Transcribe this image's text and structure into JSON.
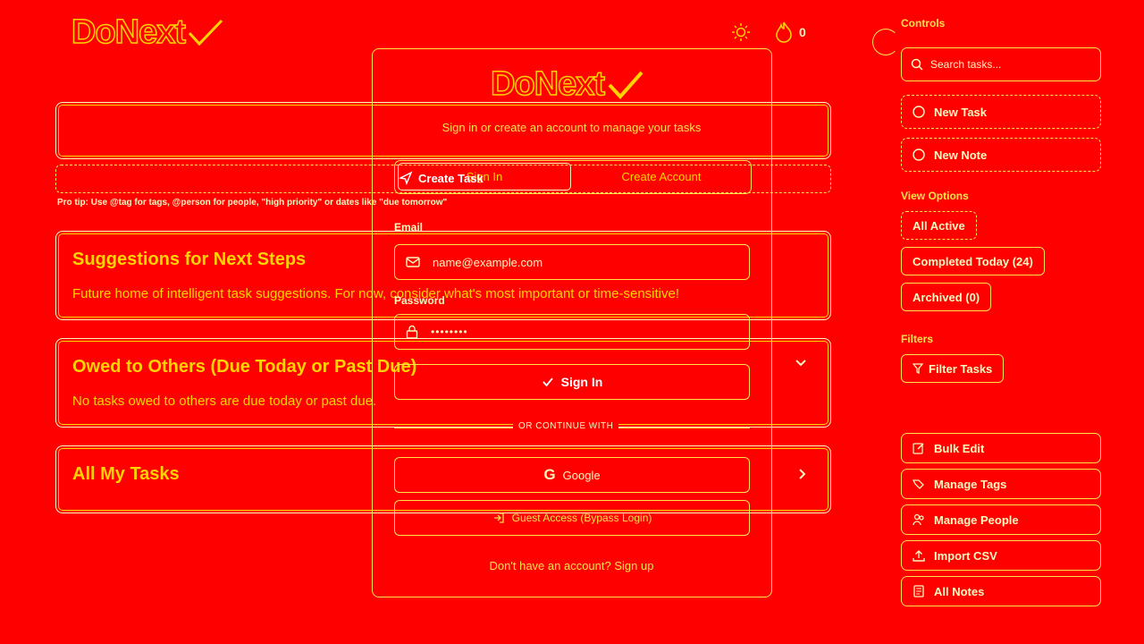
{
  "header": {
    "logo_text": "DoNext",
    "streak_count": "0"
  },
  "main": {
    "task_input_placeholder": "",
    "pro_tip": "Pro tip: Use @tag for tags, @person for people, \"high priority\" or dates like \"due tomorrow\"",
    "create_task_label": "Create Task",
    "cards": {
      "suggestions": {
        "title": "Suggestions for Next Steps",
        "text": "Future home of intelligent task suggestions. For now, consider what's most important or time-sensitive!"
      },
      "owed": {
        "title": "Owed to Others (Due Today or Past Due)",
        "text": "No tasks owed to others are due today or past due."
      },
      "all_tasks": {
        "title": "All My Tasks"
      }
    }
  },
  "modal": {
    "logo_text": "DoNext",
    "subtitle": "Sign in or create an account to manage your tasks",
    "tabs": {
      "sign_in": "Sign In",
      "create_account": "Create Account"
    },
    "email_label": "Email",
    "email_placeholder": "name@example.com",
    "password_label": "Password",
    "password_placeholder": "••••••••",
    "sign_in_button": "Sign In",
    "divider": "OR CONTINUE WITH",
    "google_button": "Google",
    "guest_button": "Guest Access (Bypass Login)",
    "signup_prompt": "Don't have an account? Sign up"
  },
  "sidebar": {
    "controls_heading": "Controls",
    "search_placeholder": "Search tasks...",
    "new_task": "New Task",
    "new_note": "New Note",
    "view_options_heading": "View Options",
    "views": [
      {
        "label": "All Active"
      },
      {
        "label": "Completed Today (24)"
      },
      {
        "label": "Archived (0)"
      }
    ],
    "filters_heading": "Filters",
    "filter_tasks": "Filter Tasks",
    "actions": [
      {
        "label": "Bulk Edit",
        "icon": "edit-icon"
      },
      {
        "label": "Manage Tags",
        "icon": "tags-icon"
      },
      {
        "label": "Manage People",
        "icon": "people-icon"
      },
      {
        "label": "Import CSV",
        "icon": "upload-icon"
      },
      {
        "label": "All Notes",
        "icon": "notes-icon"
      }
    ]
  },
  "colors": {
    "background": "#ff0000",
    "accent": "#ffd400",
    "outline": "#ffe24a",
    "light": "#fff6c0"
  }
}
